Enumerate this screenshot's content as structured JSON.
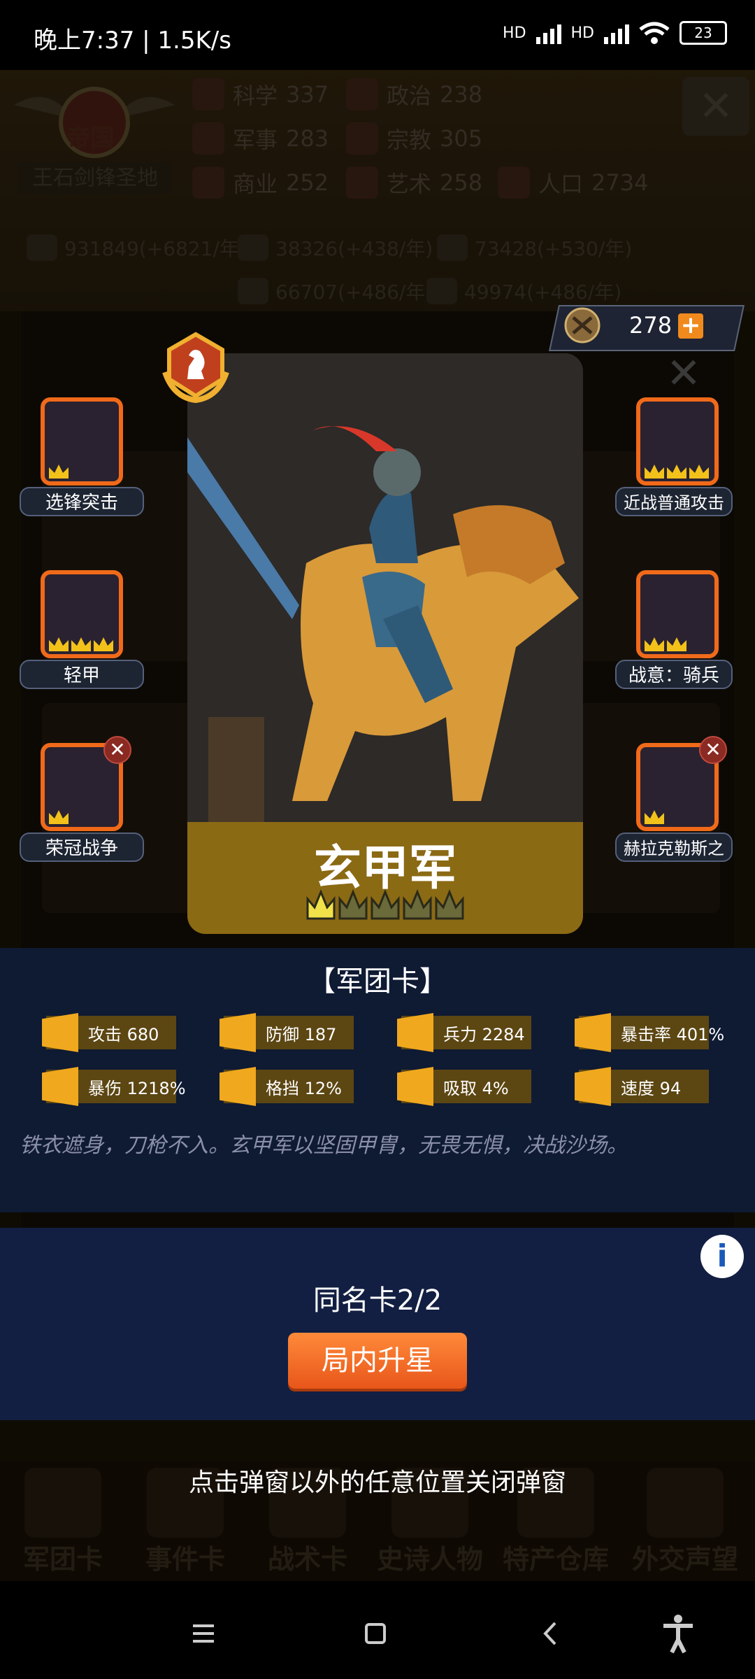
{
  "status_bar": {
    "time": "晚上7:37 | 1.5K/s",
    "signal1": "HD",
    "signal2": "HD",
    "battery": "23"
  },
  "background": {
    "kingdom_title": "帝国",
    "kingdom_name": "王石剑锋圣地",
    "stats": [
      {
        "label": "科学",
        "value": "337"
      },
      {
        "label": "政治",
        "value": "238"
      },
      {
        "label": "军事",
        "value": "283"
      },
      {
        "label": "宗教",
        "value": "305"
      },
      {
        "label": "商业",
        "value": "252"
      },
      {
        "label": "艺术",
        "value": "258"
      },
      {
        "label": "人口",
        "value": "2734"
      }
    ],
    "resources": [
      "931849(+6821/年)",
      "38326(+438/年)",
      "73428(+530/年)",
      "66707(+486/年)",
      "49974(+486/年)"
    ],
    "bottom_tabs": [
      "军团卡",
      "事件卡",
      "战术卡",
      "史诗人物",
      "特产仓库",
      "外交声望"
    ]
  },
  "currency": {
    "value": "278",
    "plus": "+"
  },
  "card": {
    "name": "玄甲军",
    "stars_filled": 1,
    "stars_total": 5
  },
  "skills_left": [
    {
      "label": "选锋突击",
      "removable": false
    },
    {
      "label": "轻甲",
      "removable": false
    },
    {
      "label": "荣冠战争",
      "removable": true
    }
  ],
  "skills_right": [
    {
      "label": "近战普通攻击",
      "removable": false
    },
    {
      "label": "战意：骑兵",
      "removable": false
    },
    {
      "label": "赫拉克勒斯之",
      "removable": true
    }
  ],
  "panel": {
    "title": "【军团卡】",
    "stats": [
      {
        "label": "攻击",
        "value": "680",
        "text": "攻击 680"
      },
      {
        "label": "防御",
        "value": "187",
        "text": "防御 187"
      },
      {
        "label": "兵力",
        "value": "2284",
        "text": "兵力 2284"
      },
      {
        "label": "暴击率",
        "value": "401%",
        "text": "暴击率 401%"
      },
      {
        "label": "暴伤",
        "value": "1218%",
        "text": "暴伤 1218%"
      },
      {
        "label": "格挡",
        "value": "12%",
        "text": "格挡 12%"
      },
      {
        "label": "吸取",
        "value": "4%",
        "text": "吸取 4%"
      },
      {
        "label": "速度",
        "value": "94",
        "text": "速度 94"
      }
    ],
    "description": "铁衣遮身，刀枪不入。玄甲军以坚固甲胄，无畏无惧，决战沙场。"
  },
  "duplicate": {
    "text": "同名卡2/2"
  },
  "upgrade_button": "局内升星",
  "close_hint": "点击弹窗以外的任意位置关闭弹窗",
  "info_icon": "i",
  "colors": {
    "accent": "#f08a1c",
    "panel": "#0f1a33",
    "stat_box": "#5c4612",
    "card_bar": "#8b6a14"
  }
}
